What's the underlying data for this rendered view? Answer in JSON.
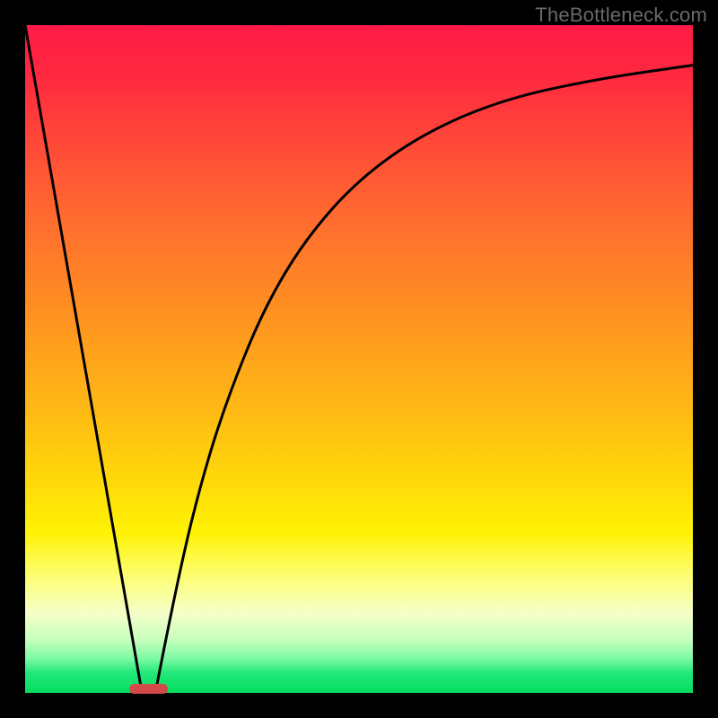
{
  "watermark": "TheBottleneck.com",
  "chart_data": {
    "type": "line",
    "title": "",
    "xlabel": "",
    "ylabel": "",
    "xlim": [
      0,
      1
    ],
    "ylim": [
      0,
      1
    ],
    "background_gradient": {
      "direction": "top-to-bottom",
      "stops": [
        {
          "pos": 0.0,
          "color": "#ff1a46"
        },
        {
          "pos": 0.5,
          "color": "#ffb516"
        },
        {
          "pos": 0.8,
          "color": "#fff205"
        },
        {
          "pos": 0.95,
          "color": "#78f9a0"
        },
        {
          "pos": 1.0,
          "color": "#05dd5f"
        }
      ]
    },
    "series": [
      {
        "name": "left-branch",
        "type": "line",
        "x": [
          0.0,
          0.175
        ],
        "y": [
          1.0,
          0.0
        ]
      },
      {
        "name": "right-branch",
        "type": "line",
        "x": [
          0.195,
          0.23,
          0.27,
          0.31,
          0.36,
          0.42,
          0.5,
          0.6,
          0.72,
          0.86,
          1.0
        ],
        "y": [
          0.0,
          0.18,
          0.34,
          0.46,
          0.58,
          0.68,
          0.77,
          0.84,
          0.89,
          0.92,
          0.94
        ]
      }
    ],
    "marker": {
      "cx": 0.185,
      "cy": 0.006,
      "w": 0.058,
      "h": 0.016,
      "color": "#d44a4a"
    },
    "stroke": {
      "color": "#000000",
      "width": 3
    }
  }
}
